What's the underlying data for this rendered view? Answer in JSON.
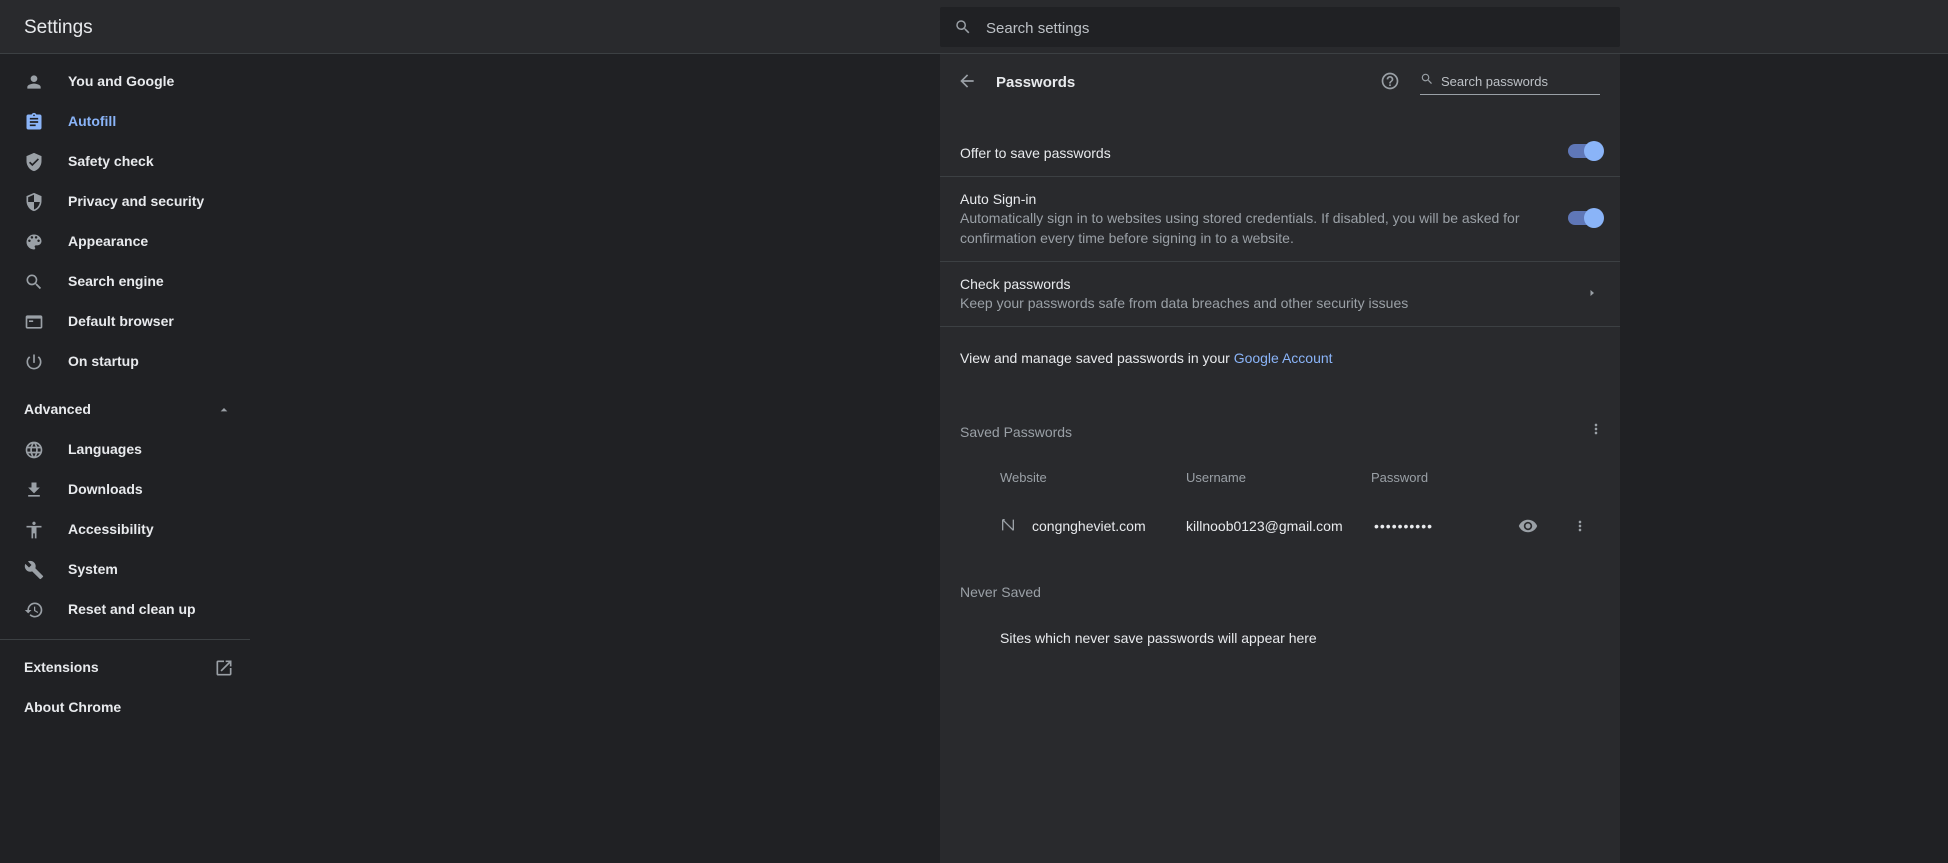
{
  "app": {
    "title": "Settings"
  },
  "search": {
    "placeholder": "Search settings"
  },
  "sidebar": {
    "items": [
      {
        "label": "You and Google",
        "icon": "person-icon"
      },
      {
        "label": "Autofill",
        "icon": "clipboard-icon",
        "active": true
      },
      {
        "label": "Safety check",
        "icon": "shield-check-icon"
      },
      {
        "label": "Privacy and security",
        "icon": "shield-icon"
      },
      {
        "label": "Appearance",
        "icon": "palette-icon"
      },
      {
        "label": "Search engine",
        "icon": "search-icon"
      },
      {
        "label": "Default browser",
        "icon": "browser-icon"
      },
      {
        "label": "On startup",
        "icon": "power-icon"
      }
    ],
    "advanced": {
      "label": "Advanced"
    },
    "advanced_items": [
      {
        "label": "Languages",
        "icon": "globe-icon"
      },
      {
        "label": "Downloads",
        "icon": "download-icon"
      },
      {
        "label": "Accessibility",
        "icon": "accessibility-icon"
      },
      {
        "label": "System",
        "icon": "wrench-icon"
      },
      {
        "label": "Reset and clean up",
        "icon": "history-icon"
      }
    ],
    "extensions": {
      "label": "Extensions"
    },
    "about": {
      "label": "About Chrome"
    }
  },
  "passwords": {
    "title": "Passwords",
    "search_placeholder": "Search passwords",
    "offer_to_save": {
      "label": "Offer to save passwords",
      "enabled": true
    },
    "auto_signin": {
      "label": "Auto Sign-in",
      "description_line1": "Automatically sign in to websites using stored credentials. If disabled, you will be asked for",
      "description_line2": "confirmation every time before signing in to a website.",
      "enabled": true
    },
    "check": {
      "label": "Check passwords",
      "description": "Keep your passwords safe from data breaches and other security issues"
    },
    "manage": {
      "prefix": "View and manage saved passwords in your ",
      "link": "Google Account"
    },
    "saved": {
      "heading": "Saved Passwords",
      "columns": {
        "website": "Website",
        "username": "Username",
        "password": "Password"
      },
      "entries": [
        {
          "website": "congngheviet.com",
          "username": "killnoob0123@gmail.com",
          "password": "••••••••••"
        }
      ]
    },
    "never_saved": {
      "heading": "Never Saved",
      "empty": "Sites which never save passwords will appear here"
    }
  },
  "colors": {
    "accent": "#8ab4f8",
    "background": "#202124",
    "card": "#292a2d"
  }
}
